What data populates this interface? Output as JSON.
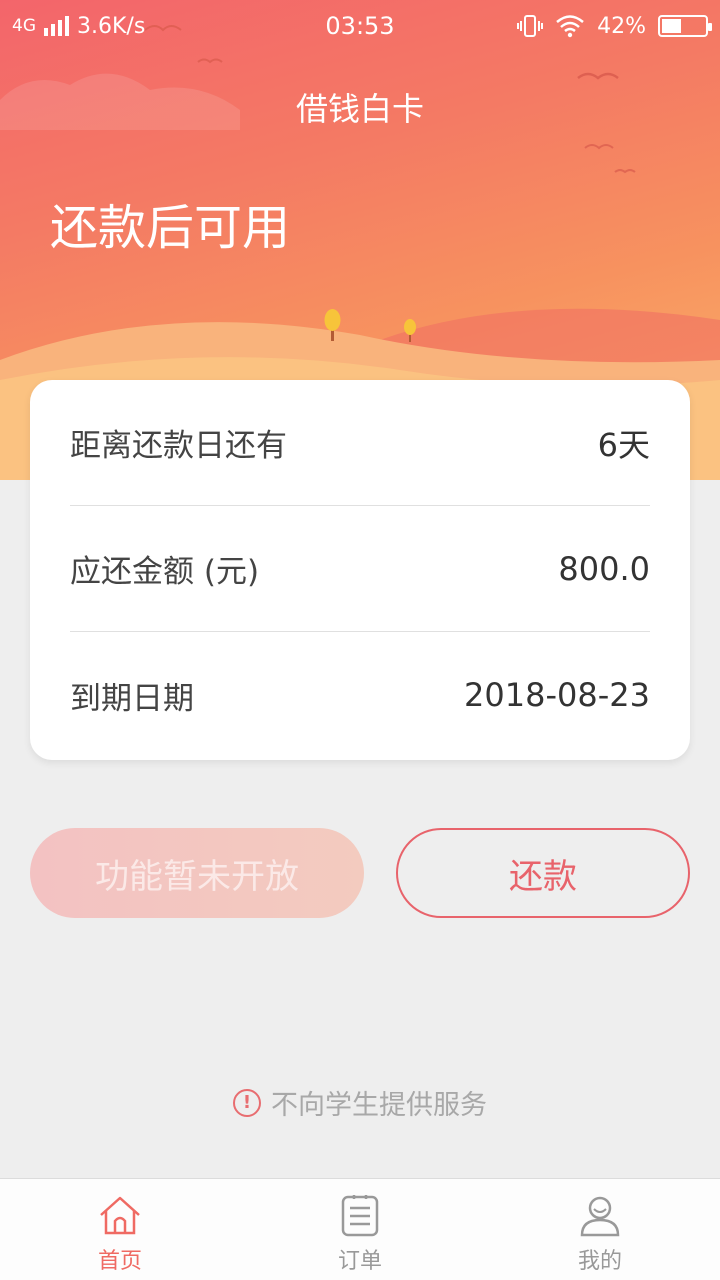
{
  "status_bar": {
    "network": "4G",
    "speed": "3.6K/s",
    "time": "03:53",
    "battery": "42%",
    "battery_level": 0.42
  },
  "header": {
    "app_title": "借钱白卡",
    "status_text": "还款后可用"
  },
  "card": {
    "rows": [
      {
        "label": "距离还款日还有",
        "value": "6天"
      },
      {
        "label": "应还金额 (元)",
        "value": "800.0"
      },
      {
        "label": "到期日期",
        "value": "2018-08-23"
      }
    ]
  },
  "actions": {
    "disabled_label": "功能暂未开放",
    "repay_label": "还款"
  },
  "notice": {
    "icon": "exclamation-icon",
    "text": "不向学生提供服务"
  },
  "tabbar": {
    "tabs": [
      {
        "label": "首页",
        "icon": "home-icon",
        "active": true
      },
      {
        "label": "订单",
        "icon": "document-icon",
        "active": false
      },
      {
        "label": "我的",
        "icon": "user-icon",
        "active": false
      }
    ]
  },
  "colors": {
    "accent": "#e8636b",
    "header_start": "#f3656b",
    "header_end": "#fbb56a",
    "active_tab": "#ef6a63"
  }
}
